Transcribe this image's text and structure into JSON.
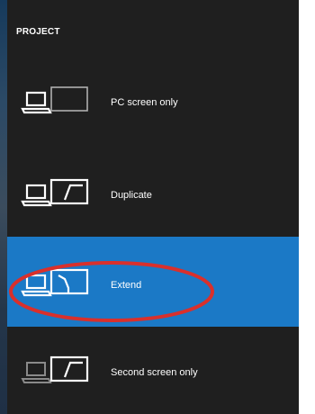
{
  "panel": {
    "title": "PROJECT"
  },
  "options": [
    {
      "label": "PC screen only",
      "icon": "pc-screen-only-icon",
      "selected": false
    },
    {
      "label": "Duplicate",
      "icon": "duplicate-icon",
      "selected": false
    },
    {
      "label": "Extend",
      "icon": "extend-icon",
      "selected": true
    },
    {
      "label": "Second screen only",
      "icon": "second-screen-only-icon",
      "selected": false
    }
  ],
  "colors": {
    "panel_background": "#1f1f1f",
    "selected_background": "#1b79c6",
    "highlight_ring": "#d9302c",
    "text": "#ffffff",
    "dimmed_icon": "#8a8a8a"
  }
}
